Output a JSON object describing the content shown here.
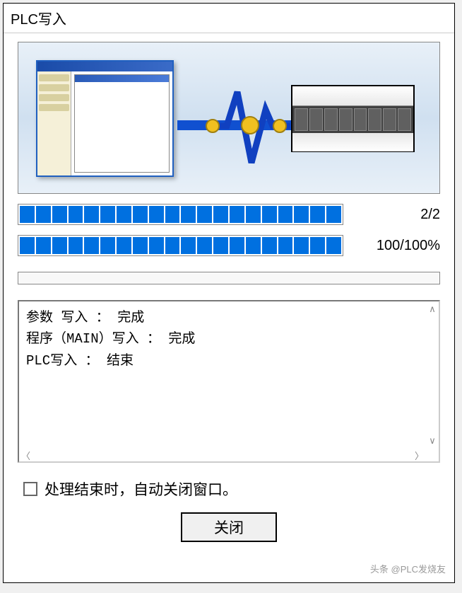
{
  "dialog": {
    "title": "PLC写入"
  },
  "progress1": {
    "label": "2/2",
    "segments": 20
  },
  "progress2": {
    "label": "100/100%",
    "segments": 20
  },
  "log": {
    "lines": [
      "参数 写入 ： 完成",
      "程序（MAIN）写入 ： 完成",
      "PLC写入 ： 结束"
    ]
  },
  "checkbox": {
    "label": "处理结束时，自动关闭窗口。",
    "checked": false
  },
  "buttons": {
    "close": "关闭"
  },
  "watermark": "头条 @PLC发烧友"
}
